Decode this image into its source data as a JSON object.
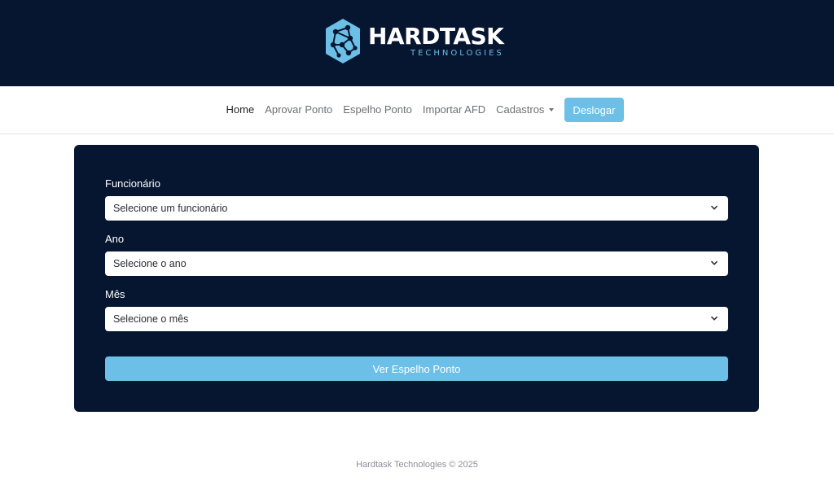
{
  "brand": {
    "name": "HARDTASK",
    "tagline": "TECHNOLOGIES",
    "colors": {
      "primary_bg": "#061630",
      "accent": "#6cbfe6"
    }
  },
  "nav": {
    "items": [
      {
        "label": "Home",
        "active": true
      },
      {
        "label": "Aprovar Ponto"
      },
      {
        "label": "Espelho Ponto"
      },
      {
        "label": "Importar AFD"
      },
      {
        "label": "Cadastros",
        "dropdown": true
      }
    ],
    "logout_label": "Deslogar"
  },
  "form": {
    "employee": {
      "label": "Funcionário",
      "value": "Selecione um funcionário",
      "icon": "chevron-down-icon"
    },
    "year": {
      "label": "Ano",
      "value": "Selecione o ano",
      "icon": "chevron-down-icon"
    },
    "month": {
      "label": "Mês",
      "value": "Selecione o mês",
      "icon": "chevron-down-icon"
    },
    "submit_label": "Ver Espelho Ponto"
  },
  "footer": {
    "text": "Hardtask Technologies © 2025"
  }
}
